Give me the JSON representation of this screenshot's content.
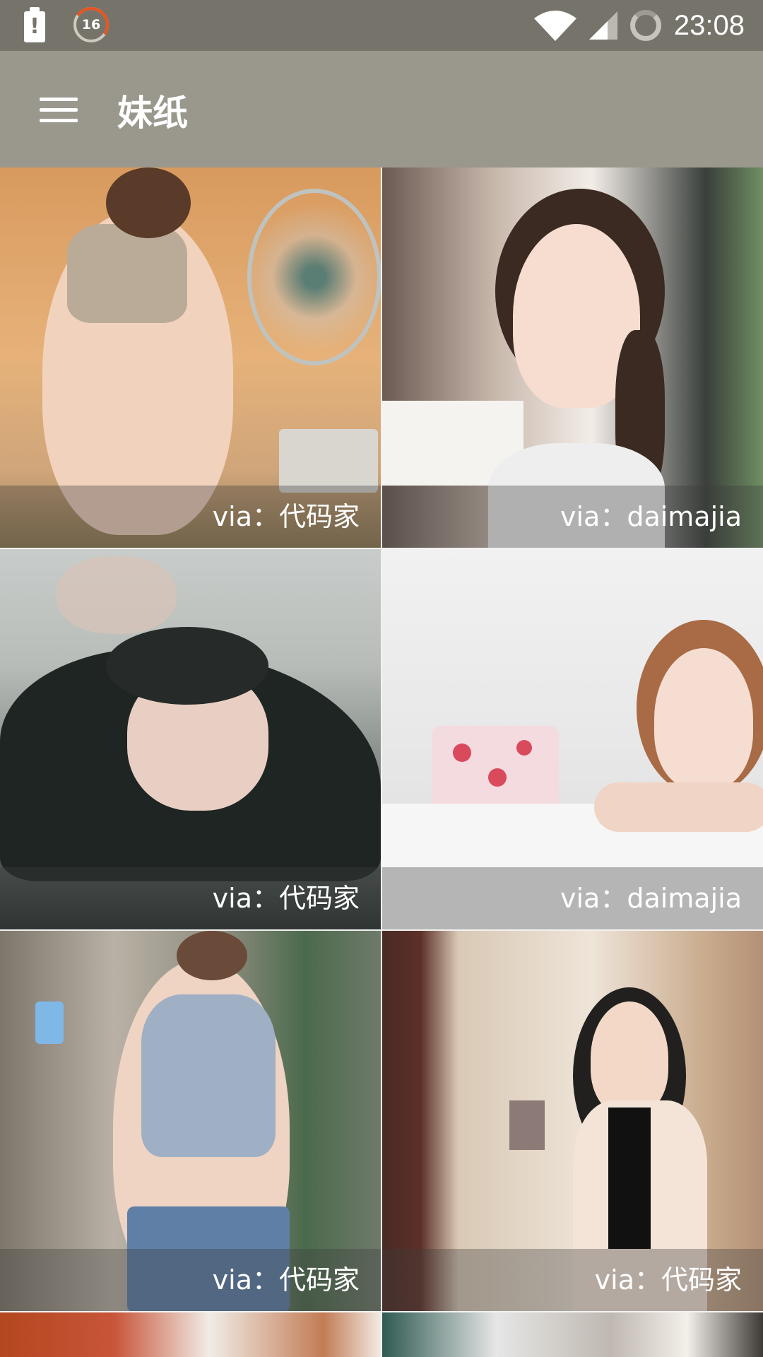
{
  "status_bar": {
    "notification_badge": "16",
    "time": "23:08"
  },
  "app_bar": {
    "title": "妹纸"
  },
  "gallery": [
    {
      "caption": "via：代码家"
    },
    {
      "caption": "via：daimajia"
    },
    {
      "caption": "via：代码家"
    },
    {
      "caption": "via：daimajia"
    },
    {
      "caption": "via：代码家"
    },
    {
      "caption": "via：代码家"
    }
  ]
}
